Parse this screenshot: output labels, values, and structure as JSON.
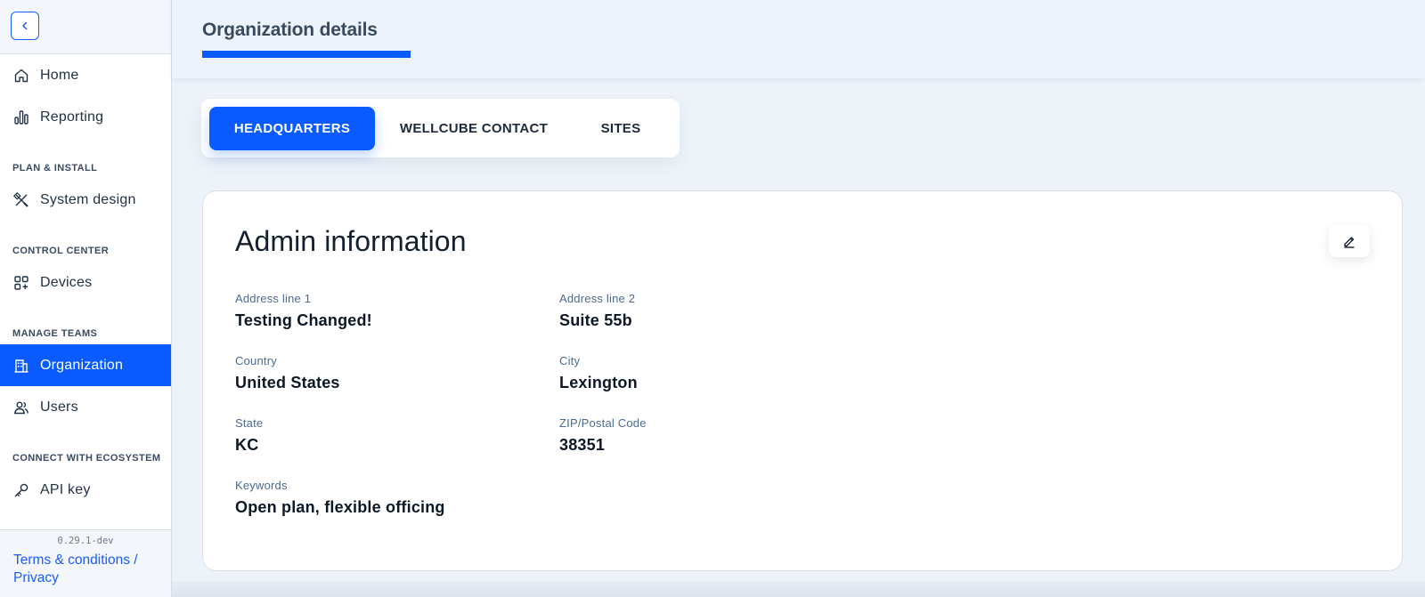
{
  "sidebar": {
    "nav": {
      "home": "Home",
      "reporting": "Reporting",
      "system_design": "System design",
      "devices": "Devices",
      "organization": "Organization",
      "users": "Users",
      "api_key": "API key"
    },
    "sections": {
      "plan_install": "PLAN & INSTALL",
      "control_center": "CONTROL CENTER",
      "manage_teams": "MANAGE TEAMS",
      "connect": "CONNECT WITH ECOSYSTEM"
    },
    "footer": {
      "version": "0.29.1-dev",
      "terms": "Terms & conditions / Privacy"
    }
  },
  "header": {
    "title": "Organization details"
  },
  "tabs": [
    "HEADQUARTERS",
    "WELLCUBE CONTACT",
    "SITES"
  ],
  "card": {
    "title": "Admin information",
    "fields": {
      "address1": {
        "label": "Address line 1",
        "value": "Testing Changed!"
      },
      "address2": {
        "label": "Address line 2",
        "value": "Suite 55b"
      },
      "country": {
        "label": "Country",
        "value": "United States"
      },
      "city": {
        "label": "City",
        "value": "Lexington"
      },
      "state": {
        "label": "State",
        "value": "KC"
      },
      "zip": {
        "label": "ZIP/Postal Code",
        "value": "38351"
      },
      "keywords": {
        "label": "Keywords",
        "value": "Open plan, flexible officing"
      }
    }
  },
  "colors": {
    "accent": "#0a5bff",
    "background": "#eef3fa",
    "label": "#4a6b8f"
  },
  "icons": [
    "chevron-left-icon",
    "home-icon",
    "bar-chart-icon",
    "tools-icon",
    "grid-plus-icon",
    "building-icon",
    "users-icon",
    "key-icon",
    "pencil-icon"
  ]
}
